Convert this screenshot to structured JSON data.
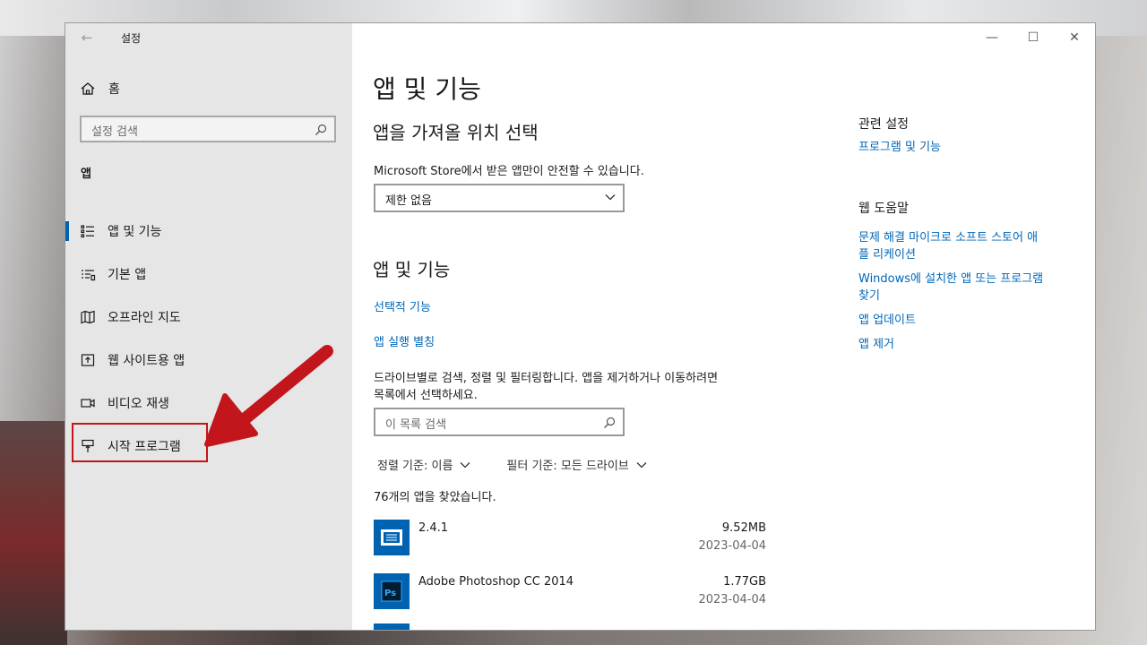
{
  "window": {
    "title": "설정",
    "back_icon": "back-arrow-icon",
    "controls": {
      "minimize": "—",
      "maximize": "☐",
      "close": "✕"
    }
  },
  "sidebar": {
    "home_label": "홈",
    "search_placeholder": "설정 검색",
    "section": "앱",
    "items": [
      {
        "label": "앱 및 기능",
        "icon": "apps-list-icon",
        "active": true
      },
      {
        "label": "기본 앱",
        "icon": "default-apps-icon",
        "active": false
      },
      {
        "label": "오프라인 지도",
        "icon": "offline-map-icon",
        "active": false
      },
      {
        "label": "웹 사이트용 앱",
        "icon": "website-apps-icon",
        "active": false
      },
      {
        "label": "비디오 재생",
        "icon": "video-icon",
        "active": false
      },
      {
        "label": "시작 프로그램",
        "icon": "startup-icon",
        "active": false
      }
    ],
    "annotation_color": "#c3161c"
  },
  "main": {
    "page_title": "앱 및 기능",
    "choose_heading": "앱을 가져올 위치 선택",
    "choose_desc": "Microsoft Store에서 받은 앱만이 안전할 수 있습니다.",
    "choose_value": "제한 없음",
    "apps_heading": "앱 및 기능",
    "optional_features_link": "선택적 기능",
    "app_alias_link": "앱 실행 별칭",
    "search_desc_line1": "드라이브별로 검색, 정렬 및 필터링합니다. 앱을 제거하거나 이동하려면",
    "search_desc_line2": "목록에서 선택하세요.",
    "list_search_placeholder": "이 목록 검색",
    "sort_label": "정렬 기준: 이름",
    "filter_label": "필터 기준: 모든 드라이브",
    "found_count": "76개의 앱을 찾았습니다.",
    "apps": [
      {
        "name": "2.4.1",
        "size": "9.52MB",
        "date": "2023-04-04",
        "icon": "app-window-icon"
      },
      {
        "name": "Adobe Photoshop CC 2014",
        "size": "1.77GB",
        "date": "2023-04-04",
        "icon": "photoshop-icon"
      }
    ],
    "accent": "#0063b1",
    "link_color": "#0067b8"
  },
  "related": {
    "heading": "관련 설정",
    "links": [
      "프로그램 및 기능"
    ],
    "help_heading": "웹 도움말",
    "help_links": [
      {
        "line1": "문제 해결 마이크로 소프트 스토어 애",
        "line2": "플 리케이션"
      },
      {
        "line1": "Windows에 설치한 앱 또는 프로그램",
        "line2": "찾기"
      },
      {
        "line1": "앱 업데이트",
        "line2": ""
      },
      {
        "line1": "앱 제거",
        "line2": ""
      }
    ]
  }
}
